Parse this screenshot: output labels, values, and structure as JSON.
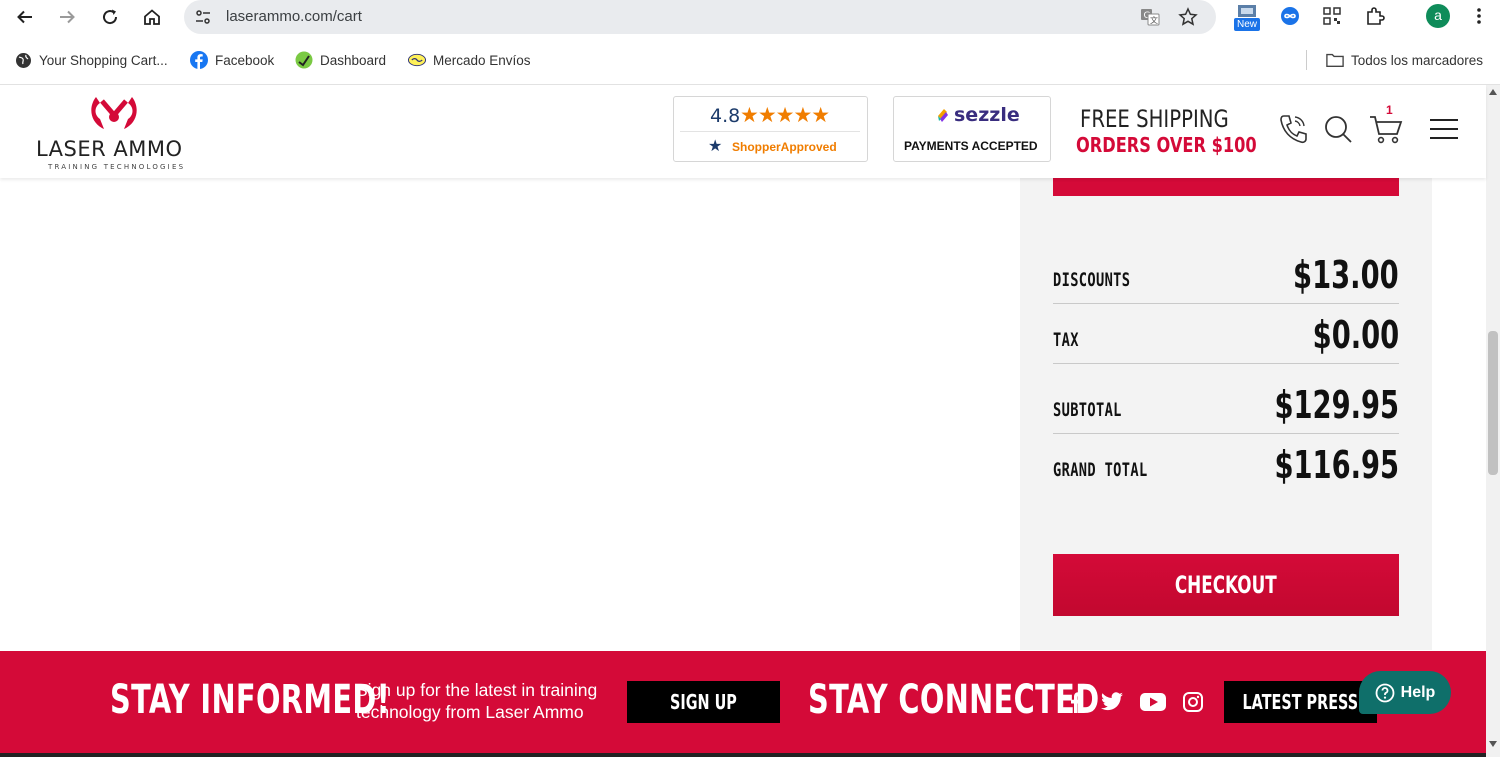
{
  "browser": {
    "url": "laserammo.com/cart",
    "extension_new_badge": "New",
    "profile_initial": "a",
    "bookmarks": [
      "Your Shopping Cart...",
      "Facebook",
      "Dashboard",
      "Mercado Envíos"
    ],
    "all_bookmarks": "Todos los marcadores"
  },
  "header": {
    "logo_text": "LASER AMMO",
    "logo_tagline": "TRAINING TECHNOLOGIES",
    "rating": "4.8",
    "rating_source": "ShopperApproved",
    "sezzle_name": "sezzle",
    "sezzle_caption": "PAYMENTS ACCEPTED",
    "shipping_line1": "FREE SHIPPING",
    "shipping_line2": "ORDERS OVER $100",
    "cart_count": "1"
  },
  "summary": {
    "rows": [
      {
        "label": "DISCOUNTS",
        "value": "$13.00"
      },
      {
        "label": "TAX",
        "value": "$0.00"
      },
      {
        "label": "SUBTOTAL",
        "value": "$129.95"
      },
      {
        "label": "GRAND TOTAL",
        "value": "$116.95"
      }
    ],
    "checkout_label": "CHECKOUT"
  },
  "footer": {
    "stay_informed": "STAY INFORMED!",
    "signup_text_line1": "Sign up for the latest in training",
    "signup_text_line2": "technology from Laser Ammo",
    "signup_button": "SIGN UP",
    "stay_connected": "STAY CONNECTED",
    "latest_press": "LATEST PRESS",
    "help_label": "Help"
  },
  "colors": {
    "brand_red": "#d40a38",
    "help_teal": "#0f6f6a"
  }
}
